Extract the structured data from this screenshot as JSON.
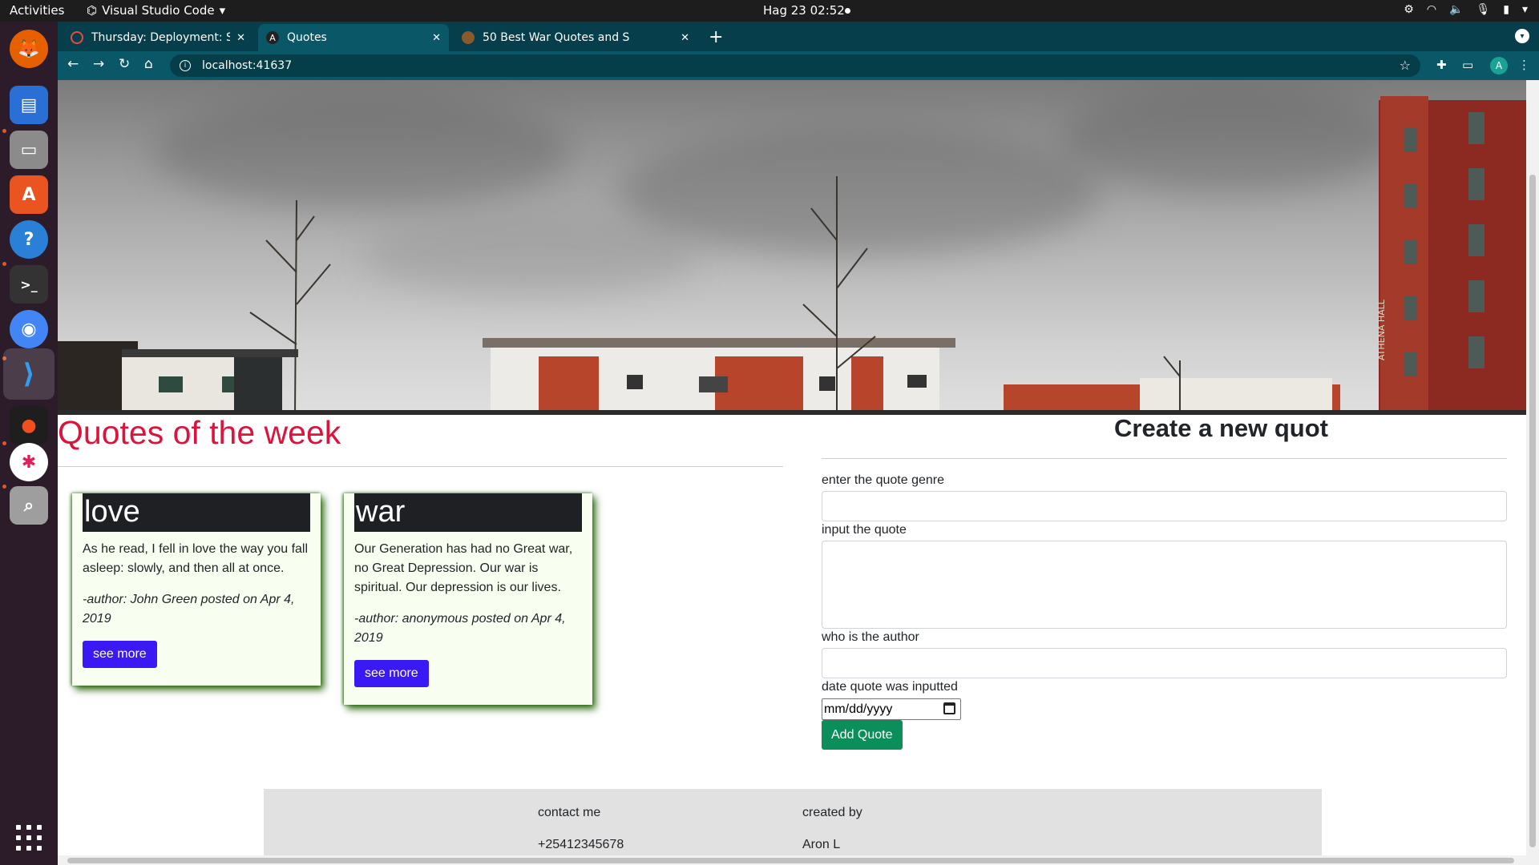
{
  "system": {
    "activities": "Activities",
    "app_name": "Visual Studio Code",
    "clock": "Hag 23  02:52"
  },
  "browser": {
    "tabs": [
      {
        "title": "Thursday: Deployment: Sl",
        "favicon": "loading-icon",
        "active": false
      },
      {
        "title": "Quotes",
        "favicon": "angular-icon",
        "active": true
      },
      {
        "title": "50 Best War Quotes and S",
        "favicon": "site-icon",
        "active": false
      }
    ],
    "url": "localhost:41637",
    "profile_initial": "A"
  },
  "page": {
    "heading_left": "Quotes of the week",
    "heading_right": "Create a new quot",
    "quotes": [
      {
        "genre": "love",
        "text": "As he read, I fell in love the way you fall asleep: slowly, and then all at once.",
        "meta": "-author: John Green posted on Apr 4, 2019",
        "button": "see more"
      },
      {
        "genre": "war",
        "text": "Our Generation has had no Great war, no Great Depression. Our war is spiritual. Our depression is our lives.",
        "meta": "-author: anonymous posted on Apr 4, 2019",
        "button": "see more"
      }
    ],
    "form": {
      "genre_label": "enter the quote genre",
      "quote_label": "input the quote",
      "author_label": "who is the author",
      "date_label": "date quote was inputted",
      "date_placeholder": "mm/dd/yyyy",
      "submit_label": "Add Quote"
    },
    "footer": {
      "contact_heading": "contact me",
      "contact_value": "+25412345678",
      "created_heading": "created by",
      "created_value": "Aron L"
    }
  },
  "colors": {
    "heading_accent": "#dc143c",
    "see_more_button": "#3b19f5",
    "add_quote_button": "#0c8e5b",
    "chrome_tab_strip": "#063f4b",
    "chrome_toolbar": "#0a5767"
  }
}
